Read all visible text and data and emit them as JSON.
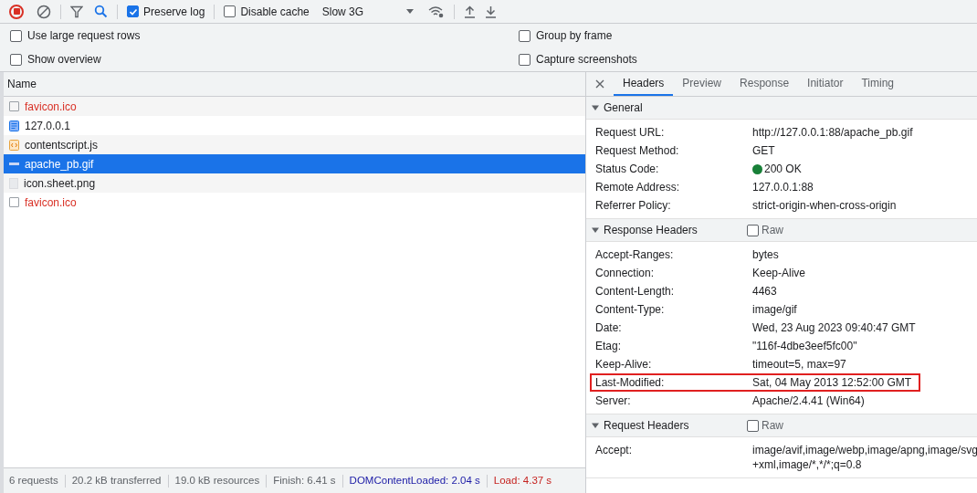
{
  "toolbar": {
    "recording": true,
    "search_active": true,
    "preserve_log": {
      "label": "Preserve log",
      "checked": true
    },
    "disable_cache": {
      "label": "Disable cache",
      "checked": false
    },
    "throttling": "Slow 3G"
  },
  "settings": [
    {
      "label": "Use large request rows",
      "checked": false
    },
    {
      "label": "Group by frame",
      "checked": false
    },
    {
      "label": "Show overview",
      "checked": false
    },
    {
      "label": "Capture screenshots",
      "checked": false
    }
  ],
  "requests": {
    "column": "Name",
    "rows": [
      {
        "name": "favicon.ico",
        "kind": "blank",
        "failed": true,
        "selected": false
      },
      {
        "name": "127.0.0.1",
        "kind": "document",
        "failed": false,
        "selected": false
      },
      {
        "name": "contentscript.js",
        "kind": "script",
        "failed": false,
        "selected": false
      },
      {
        "name": "apache_pb.gif",
        "kind": "gif",
        "failed": false,
        "selected": true
      },
      {
        "name": "icon.sheet.png",
        "kind": "image",
        "failed": false,
        "selected": false
      },
      {
        "name": "favicon.ico",
        "kind": "blank",
        "failed": true,
        "selected": false
      }
    ]
  },
  "detail_tabs": [
    {
      "label": "Headers",
      "selected": true
    },
    {
      "label": "Preview",
      "selected": false
    },
    {
      "label": "Response",
      "selected": false
    },
    {
      "label": "Initiator",
      "selected": false
    },
    {
      "label": "Timing",
      "selected": false
    }
  ],
  "sections": [
    {
      "title": "General",
      "expanded": true,
      "rows": [
        {
          "key": "Request URL:",
          "value_lines": [
            "http://127.0.0.1:88/apache_pb.gif"
          ],
          "highlighted": false
        },
        {
          "key": "Request Method:",
          "value_lines": [
            "GET"
          ],
          "highlighted": false
        },
        {
          "key": "Status Code:",
          "value_lines": [
            "200 OK"
          ],
          "status_ok": true,
          "highlighted": false
        },
        {
          "key": "Remote Address:",
          "value_lines": [
            "127.0.0.1:88"
          ],
          "highlighted": false
        },
        {
          "key": "Referrer Policy:",
          "value_lines": [
            "strict-origin-when-cross-origin"
          ],
          "highlighted": false
        }
      ]
    },
    {
      "title": "Response Headers",
      "expanded": true,
      "raw": {
        "label": "Raw",
        "checked": false
      },
      "rows": [
        {
          "key": "Accept-Ranges:",
          "value_lines": [
            "bytes"
          ],
          "highlighted": false
        },
        {
          "key": "Connection:",
          "value_lines": [
            "Keep-Alive"
          ],
          "highlighted": false
        },
        {
          "key": "Content-Length:",
          "value_lines": [
            "4463"
          ],
          "highlighted": false
        },
        {
          "key": "Content-Type:",
          "value_lines": [
            "image/gif"
          ],
          "highlighted": false
        },
        {
          "key": "Date:",
          "value_lines": [
            "Wed, 23 Aug 2023 09:40:47 GMT"
          ],
          "highlighted": false
        },
        {
          "key": "Etag:",
          "value_lines": [
            "\"116f-4dbe3eef5fc00\""
          ],
          "highlighted": false
        },
        {
          "key": "Keep-Alive:",
          "value_lines": [
            "timeout=5, max=97"
          ],
          "highlighted": false
        },
        {
          "key": "Last-Modified:",
          "value_lines": [
            "Sat, 04 May 2013 12:52:00 GMT"
          ],
          "highlighted": true
        },
        {
          "key": "Server:",
          "value_lines": [
            "Apache/2.4.41 (Win64)"
          ],
          "highlighted": false
        }
      ]
    },
    {
      "title": "Request Headers",
      "expanded": true,
      "raw": {
        "label": "Raw",
        "checked": false
      },
      "rows": [
        {
          "key": "Accept:",
          "value_lines": [
            "image/avif,image/webp,image/apng,image/svg",
            "+xml,image/*,*/*;q=0.8"
          ],
          "highlighted": false
        }
      ]
    }
  ],
  "status_bar": [
    {
      "text": "6 requests",
      "kind": "plain"
    },
    {
      "text": "20.2 kB transferred",
      "kind": "plain"
    },
    {
      "text": "19.0 kB resources",
      "kind": "plain"
    },
    {
      "text": "Finish: 6.41 s",
      "kind": "plain"
    },
    {
      "text": "DOMContentLoaded: 2.04 s",
      "kind": "dom"
    },
    {
      "text": "Load: 4.37 s",
      "kind": "load"
    }
  ]
}
